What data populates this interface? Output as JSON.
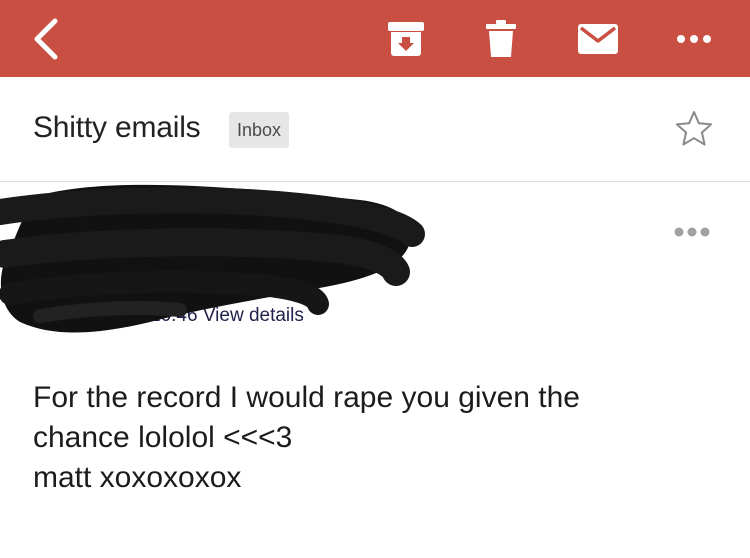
{
  "colors": {
    "toolbar_background": "#c84f42",
    "toolbar_icons": "#ffffff",
    "redaction": "#111111"
  },
  "toolbar": {
    "back_icon": "chevron-left-icon",
    "archive_icon": "archive-icon",
    "delete_icon": "trash-icon",
    "mark_unread_icon": "envelope-icon",
    "more_icon": "more-horizontal-icon"
  },
  "email": {
    "subject": "Shitty emails",
    "label_badge": "Inbox",
    "star_icon": "star-outline-icon",
    "sender_more_icon": "more-horizontal-icon",
    "meta_partial": "10:46  View details",
    "body": "For the record I would rape you given the\nchance lololol <<<3\nmatt xoxoxoxox"
  }
}
